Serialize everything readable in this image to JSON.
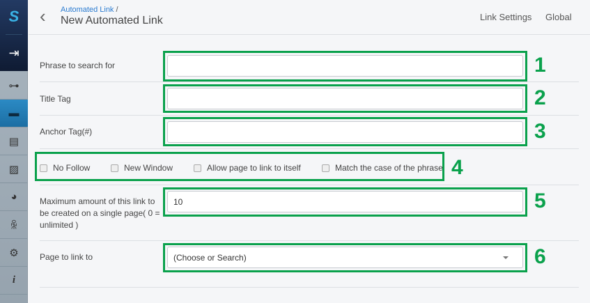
{
  "sidebar": {
    "items": [
      {
        "icon": "sitemap-icon"
      },
      {
        "icon": "briefcase-icon",
        "active": true
      },
      {
        "icon": "document-icon"
      },
      {
        "icon": "image-icon"
      },
      {
        "icon": "pie-chart-icon"
      },
      {
        "icon": "people-icon"
      },
      {
        "icon": "gears-icon"
      },
      {
        "icon": "info-icon"
      }
    ]
  },
  "header": {
    "breadcrumb": "Automated Link",
    "breadcrumb_sep": "/",
    "title": "New Automated Link",
    "tabs": [
      "Link Settings",
      "Global"
    ]
  },
  "form": {
    "phrase_label": "Phrase to search for",
    "phrase_value": "",
    "title_label": "Title Tag",
    "title_value": "",
    "anchor_label": "Anchor Tag(#)",
    "anchor_value": "",
    "checkboxes": [
      "No Follow",
      "New Window",
      "Allow page to link to itself",
      "Match the case of the phrase"
    ],
    "max_label": "Maximum amount of this link to be created on a single page( 0 = unlimited )",
    "max_value": "10",
    "page_label": "Page to link to",
    "page_value": "(Choose or Search)"
  },
  "annotations": [
    "1",
    "2",
    "3",
    "4",
    "5",
    "6"
  ],
  "colors": {
    "annotation": "#0aa14c",
    "accent": "#2a7bd0",
    "active_sidebar": "#2b8ac4"
  }
}
